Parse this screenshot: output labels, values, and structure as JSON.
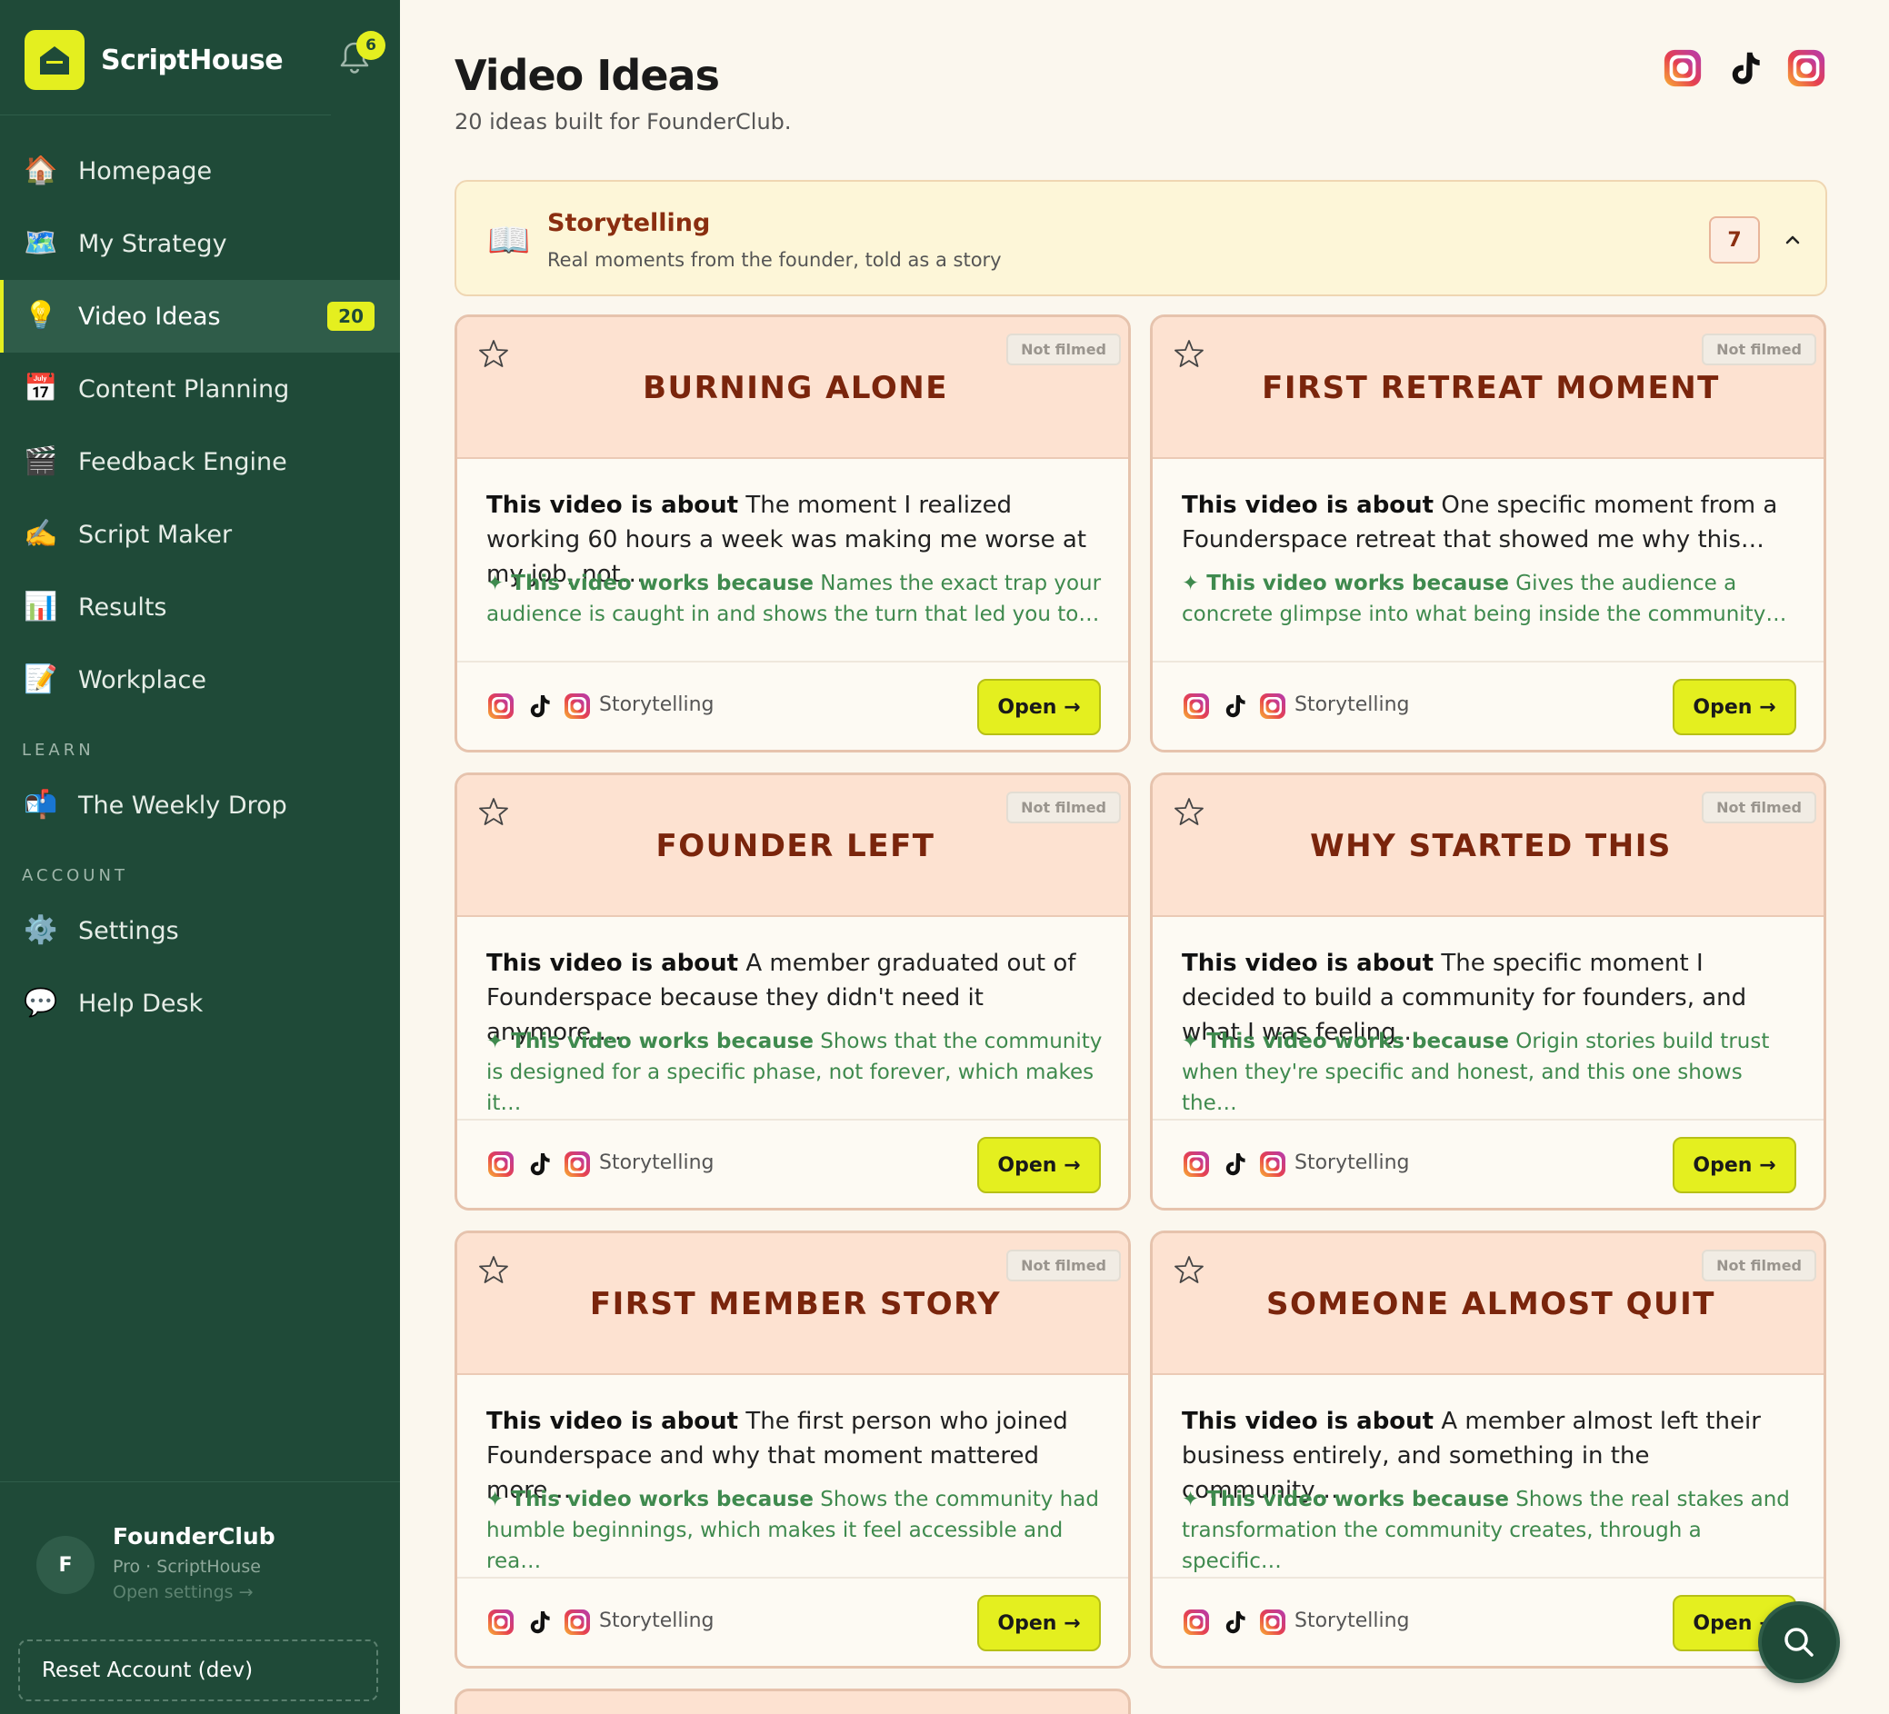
{
  "app": {
    "name": "ScriptHouse",
    "notifications": "6"
  },
  "nav": {
    "items": [
      {
        "label": "Homepage",
        "icon": "house-icon",
        "emoji": "🏠"
      },
      {
        "label": "My Strategy",
        "icon": "map-icon",
        "emoji": "🗺️"
      },
      {
        "label": "Video Ideas",
        "icon": "lightbulb-icon",
        "emoji": "💡",
        "count": "20"
      },
      {
        "label": "Content Planning",
        "icon": "calendar-icon",
        "emoji": "📅"
      },
      {
        "label": "Feedback Engine",
        "icon": "clapper-icon",
        "emoji": "🎬"
      },
      {
        "label": "Script Maker",
        "icon": "writing-hand-icon",
        "emoji": "✍️"
      },
      {
        "label": "Results",
        "icon": "bar-chart-icon",
        "emoji": "📊"
      },
      {
        "label": "Workplace",
        "icon": "memo-icon",
        "emoji": "📝"
      }
    ],
    "learn_section": "LEARN",
    "learn_items": [
      {
        "label": "The Weekly Drop",
        "icon": "mailbox-icon",
        "emoji": "📬"
      }
    ],
    "account_section": "ACCOUNT",
    "account_items": [
      {
        "label": "Settings",
        "icon": "gear-icon",
        "emoji": "⚙️"
      },
      {
        "label": "Help Desk",
        "icon": "speech-bubble-icon",
        "emoji": "💬"
      }
    ]
  },
  "account": {
    "initial": "F",
    "name": "FounderClub",
    "plan": "Pro · ScriptHouse",
    "link": "Open settings →",
    "reset": "Reset Account (dev)"
  },
  "header": {
    "title": "Video Ideas",
    "subtitle": "20 ideas built for FounderClub."
  },
  "category": {
    "icon": "📖",
    "title": "Storytelling",
    "description": "Real moments from the founder, told as a story",
    "count": "7"
  },
  "labels": {
    "about": "This video is about",
    "works": "✦ This video works because",
    "open": "Open →"
  },
  "cards": [
    {
      "title": "BURNING ALONE",
      "status": "Not filmed",
      "about": "The moment I realized working 60 hours a week was making me worse at my job, not…",
      "works": "Names the exact trap your audience is caught in and shows the turn that led you to…",
      "tag": "Storytelling"
    },
    {
      "title": "FIRST RETREAT MOMENT",
      "status": "Not filmed",
      "about": "One specific moment from a Founderspace retreat that showed me why this…",
      "works": "Gives the audience a concrete glimpse into what being inside the community…",
      "tag": "Storytelling"
    },
    {
      "title": "FOUNDER LEFT",
      "status": "Not filmed",
      "about": "A member graduated out of Founderspace because they didn't need it anymore.…",
      "works": "Shows that the community is designed for a specific phase, not forever, which makes it…",
      "tag": "Storytelling"
    },
    {
      "title": "WHY STARTED THIS",
      "status": "Not filmed",
      "about": "The specific moment I decided to build a community for founders, and what I was feeling…",
      "works": "Origin stories build trust when they're specific and honest, and this one shows the…",
      "tag": "Storytelling"
    },
    {
      "title": "FIRST MEMBER STORY",
      "status": "Not filmed",
      "about": "The first person who joined Founderspace and why that moment mattered more…",
      "works": "Shows the community had humble beginnings, which makes it feel accessible and rea…",
      "tag": "Storytelling"
    },
    {
      "title": "SOMEONE ALMOST QUIT",
      "status": "Not filmed",
      "about": "A member almost left their business entirely, and something in the community…",
      "works": "Shows the real stakes and transformation the community creates, through a specific…",
      "tag": "Storytelling"
    }
  ],
  "colors": {
    "sidebar": "#1f4a38",
    "accent": "#e4ef1f",
    "card_head": "#fde2d1",
    "title": "#7a250c",
    "works": "#3f8a4e"
  }
}
